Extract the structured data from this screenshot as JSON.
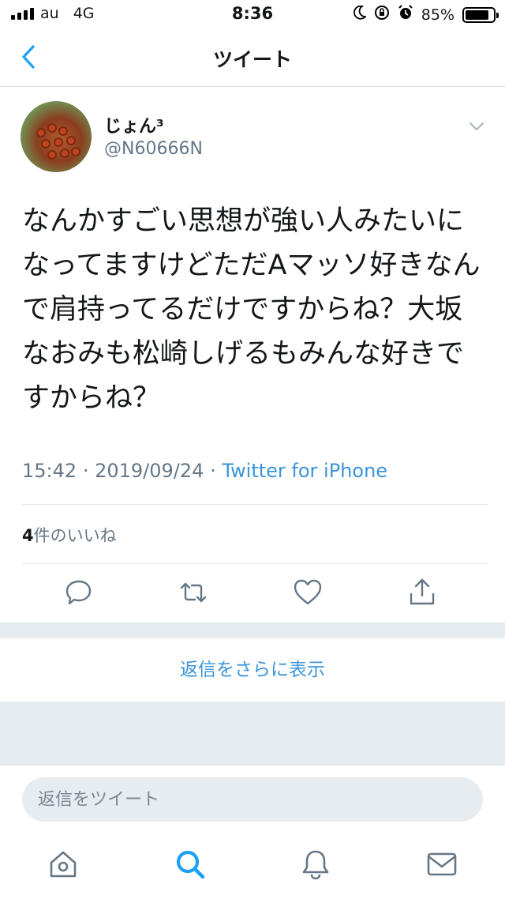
{
  "status_bar": {
    "carrier": "au",
    "network": "4G",
    "time": "8:36",
    "battery_percent": "85%",
    "battery_level": 0.85,
    "icons": [
      "moon-icon",
      "rotation-lock-icon",
      "alarm-icon"
    ]
  },
  "nav": {
    "title": "ツイート"
  },
  "tweet": {
    "display_name": "じょん³",
    "handle": "@N60666N",
    "text": "なんかすごい思想が強い人みたいになってますけどただAマッソ好きなんで肩持ってるだけですからね？大坂なおみも松崎しげるもみんな好きですからね？",
    "time": "15:42",
    "date": "2019/09/24",
    "separator": "·",
    "source": "Twitter for iPhone",
    "likes_count": "4",
    "likes_label": "件のいいね"
  },
  "actions": [
    "reply-icon",
    "retweet-icon",
    "like-icon",
    "share-icon"
  ],
  "more_replies_label": "返信をさらに表示",
  "reply_placeholder": "返信をツイート",
  "tabs": [
    "home-icon",
    "search-icon",
    "notifications-icon",
    "messages-icon"
  ],
  "colors": {
    "accent": "#1da1f2",
    "link": "#3b94d9",
    "muted": "#657786",
    "band": "#e6ecf0"
  }
}
